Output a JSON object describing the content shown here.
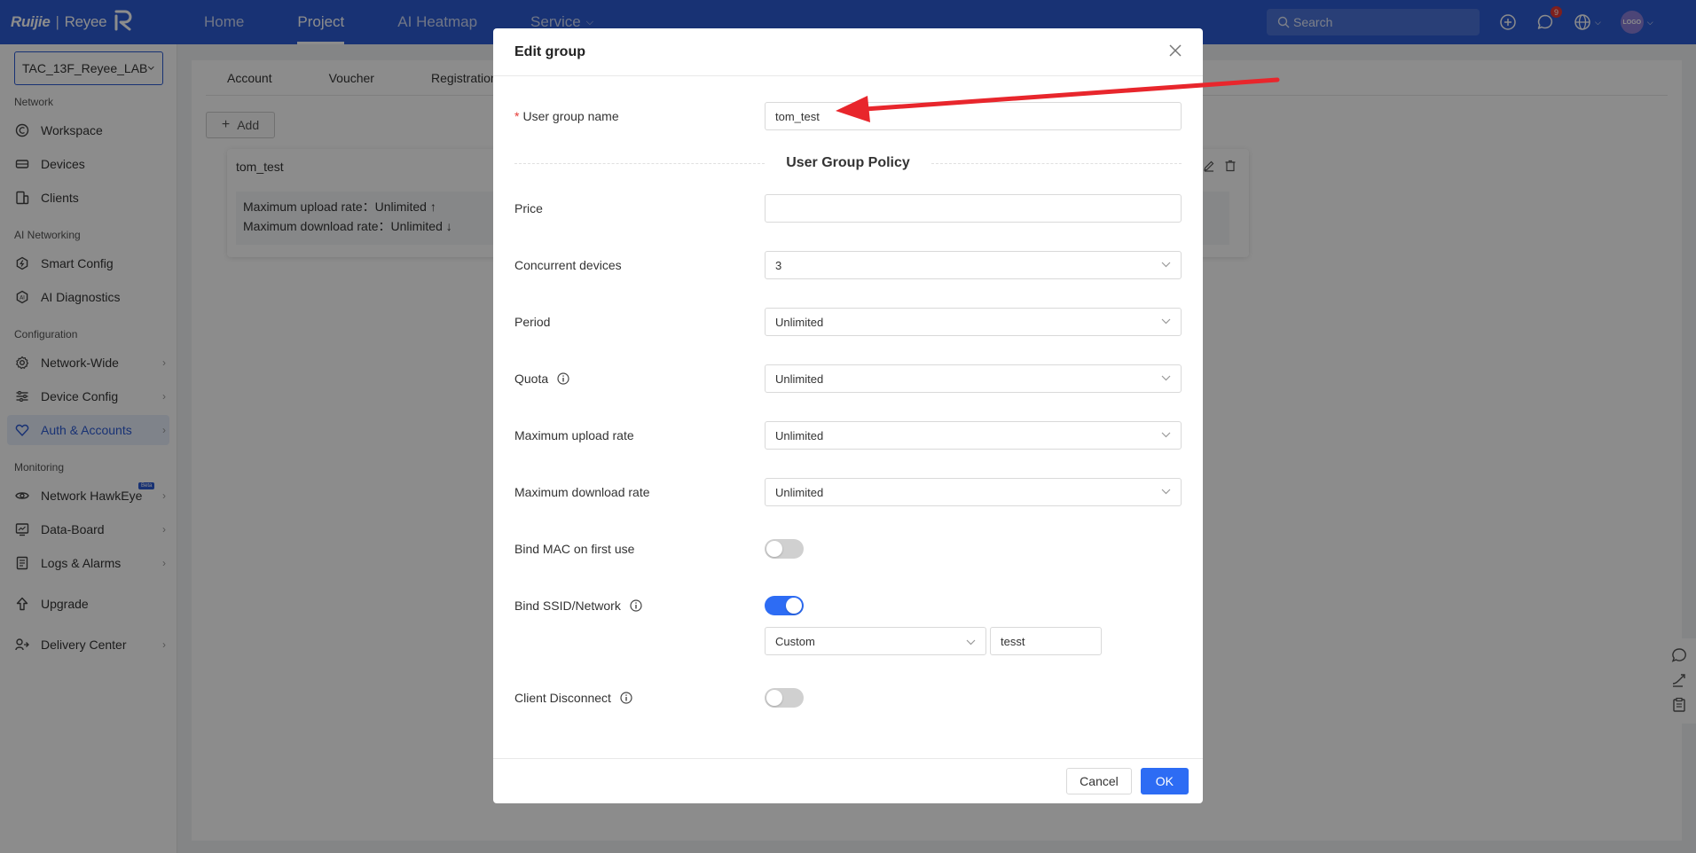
{
  "brand": {
    "ruijie": "Ruijie",
    "reyee": "Reyee"
  },
  "nav": {
    "home": "Home",
    "project": "Project",
    "ai_heatmap": "AI Heatmap",
    "service": "Service"
  },
  "search": {
    "placeholder": "Search"
  },
  "notifications": {
    "count": "9"
  },
  "avatar": {
    "text": "LOGO"
  },
  "sidebar": {
    "project": "TAC_13F_Reyee_LAB",
    "sections": {
      "network": "Network",
      "ai_networking": "AI Networking",
      "configuration": "Configuration",
      "monitoring": "Monitoring"
    },
    "items": {
      "workspace": "Workspace",
      "devices": "Devices",
      "clients": "Clients",
      "smart_config": "Smart Config",
      "ai_diagnostics": "AI Diagnostics",
      "network_wide": "Network-Wide",
      "device_config": "Device Config",
      "auth_accounts": "Auth & Accounts",
      "network_hawkeye": "Network HawkEye",
      "beta": "Beta",
      "data_board": "Data-Board",
      "logs_alarms": "Logs & Alarms",
      "upgrade": "Upgrade",
      "delivery_center": "Delivery Center"
    }
  },
  "tabs": {
    "account": "Account",
    "voucher": "Voucher",
    "registration": "Registration"
  },
  "add_label": "Add",
  "group_card": {
    "name": "tom_test",
    "upload": "Maximum upload rate：Unlimited ↑",
    "download": "Maximum download rate：Unlimited ↓"
  },
  "modal": {
    "title": "Edit group",
    "user_group_name_label": "User group name",
    "user_group_name_value": "tom_test",
    "policy_title": "User Group Policy",
    "price_label": "Price",
    "price_value": "",
    "concurrent_label": "Concurrent devices",
    "concurrent_value": "3",
    "period_label": "Period",
    "period_value": "Unlimited",
    "quota_label": "Quota",
    "quota_value": "Unlimited",
    "upload_label": "Maximum upload rate",
    "upload_value": "Unlimited",
    "download_label": "Maximum download rate",
    "download_value": "Unlimited",
    "bind_mac_label": "Bind MAC on first use",
    "bind_mac_on": false,
    "bind_ssid_label": "Bind SSID/Network",
    "bind_ssid_on": true,
    "ssid_mode": "Custom",
    "ssid_value": "tesst",
    "client_disconnect_label": "Client Disconnect",
    "client_disconnect_on": false,
    "cancel": "Cancel",
    "ok": "OK"
  },
  "colors": {
    "primary": "#2d5bd3",
    "accent": "#2d6cf4",
    "annotation_arrow": "#e8262c"
  }
}
